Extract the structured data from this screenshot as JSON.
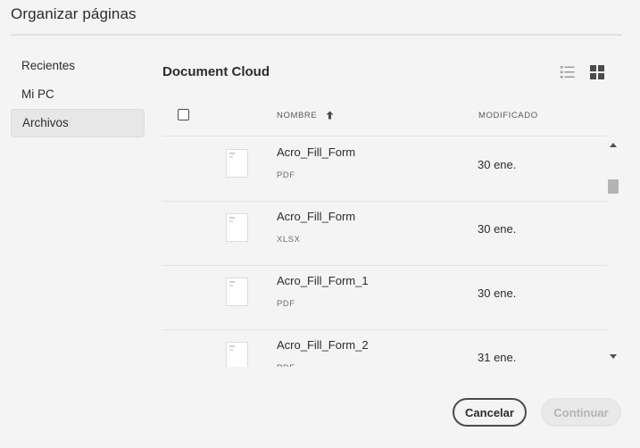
{
  "dialog": {
    "title": "Organizar páginas"
  },
  "sidebar": {
    "items": [
      {
        "label": "Recientes"
      },
      {
        "label": "Mi PC"
      },
      {
        "label": "Archivos",
        "active": true
      }
    ]
  },
  "main": {
    "title": "Document Cloud",
    "view_icons": [
      "list-view-icon",
      "grid-view-icon"
    ],
    "columns": {
      "name": "NOMBRE",
      "modified": "MODIFICADO",
      "sort_icon": "arrow-up-icon"
    },
    "files": [
      {
        "name": "Acro_Fill_Form",
        "type": "PDF",
        "modified": "30 ene."
      },
      {
        "name": "Acro_Fill_Form",
        "type": "XLSX",
        "modified": "30 ene."
      },
      {
        "name": "Acro_Fill_Form_1",
        "type": "PDF",
        "modified": "30 ene."
      },
      {
        "name": "Acro_Fill_Form_2",
        "type": "PDF",
        "modified": "31 ene."
      }
    ]
  },
  "footer": {
    "cancel_label": "Cancelar",
    "continue_label": "Continuar"
  },
  "colors": {
    "background": "#f4f4f4",
    "text": "#2c2c2c",
    "disabled_text": "#b3b3b3",
    "active_nav": "#e7e7e7"
  }
}
